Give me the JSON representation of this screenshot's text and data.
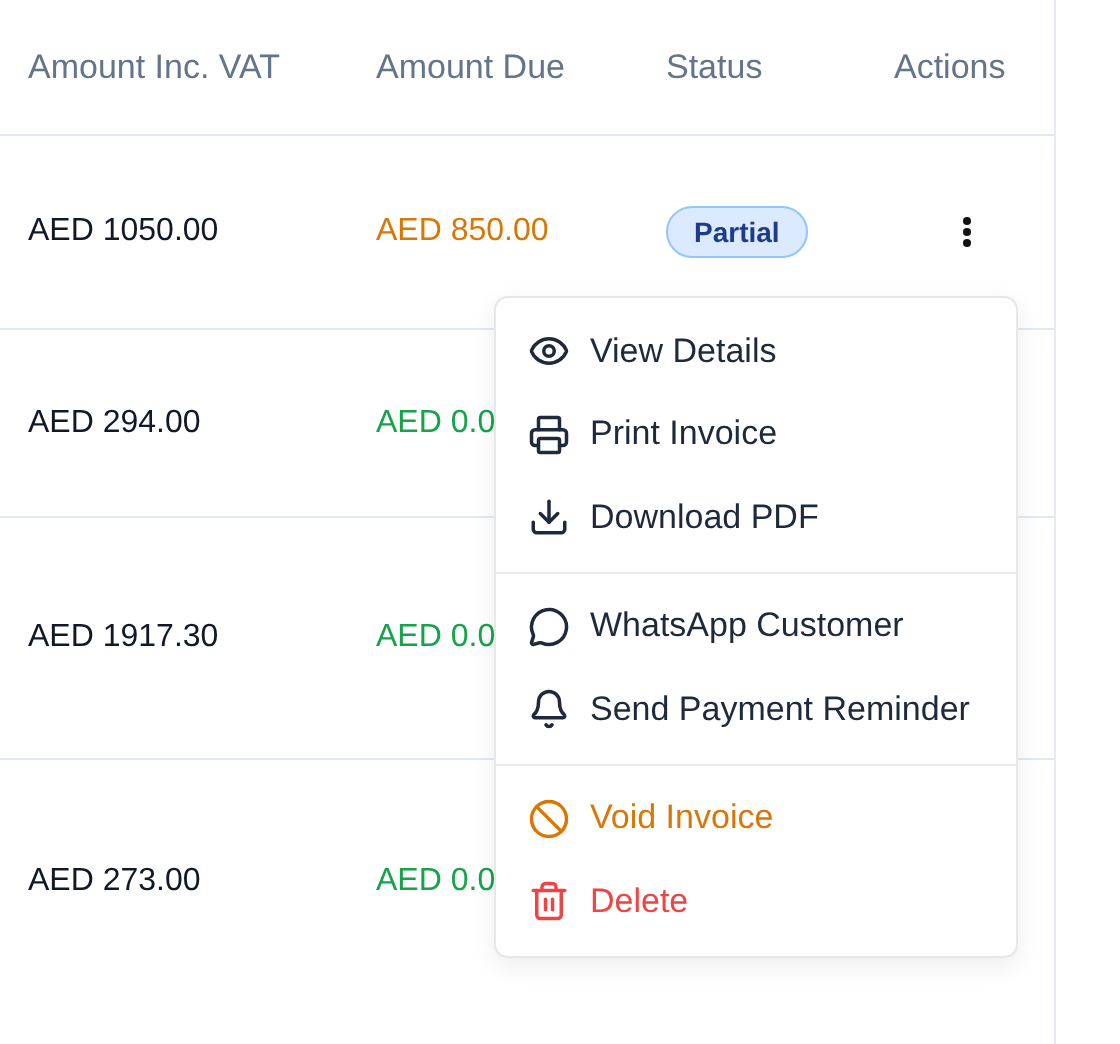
{
  "table": {
    "columns": [
      "Amount Inc. VAT",
      "Amount Due",
      "Status",
      "Actions"
    ],
    "rows": [
      {
        "amount_inc_vat": "AED 1050.00",
        "amount_due": {
          "text": "AED 850.00",
          "color": "#d97706"
        },
        "status": "Partial"
      },
      {
        "amount_inc_vat": "AED 294.00",
        "amount_due": {
          "text": "AED 0.0",
          "color": "#16a34a"
        }
      },
      {
        "amount_inc_vat": "AED 1917.30",
        "amount_due": {
          "text": "AED 0.0",
          "color": "#16a34a"
        }
      },
      {
        "amount_inc_vat": "AED 273.00",
        "amount_due": {
          "text": "AED 0.0",
          "color": "#16a34a"
        }
      }
    ]
  },
  "actions_menu": {
    "groups": [
      [
        {
          "label": "View Details",
          "kind": "normal"
        },
        {
          "label": "Print Invoice",
          "kind": "normal"
        },
        {
          "label": "Download PDF",
          "kind": "normal"
        }
      ],
      [
        {
          "label": "WhatsApp Customer",
          "kind": "normal"
        },
        {
          "label": "Send Payment Reminder",
          "kind": "normal"
        }
      ],
      [
        {
          "label": "Void Invoice",
          "kind": "warning"
        },
        {
          "label": "Delete",
          "kind": "danger"
        }
      ]
    ]
  }
}
